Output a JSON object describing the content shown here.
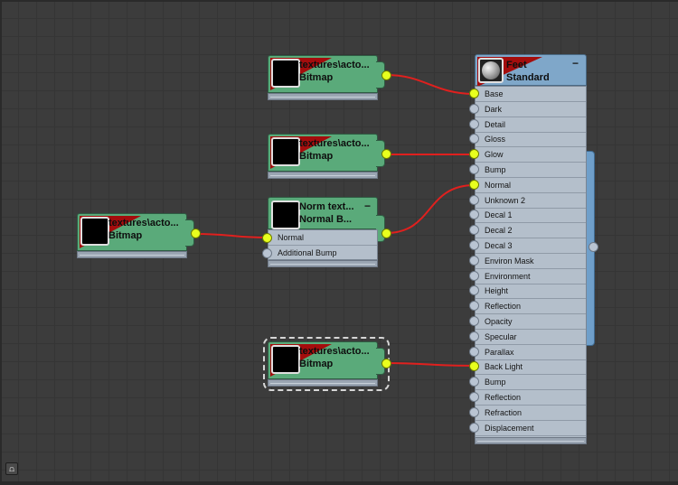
{
  "nodes": {
    "bitmap_base": {
      "line1": "textures\\acto...",
      "line2": "Bitmap"
    },
    "bitmap_glow": {
      "line1": "textures\\acto...",
      "line2": "Bitmap"
    },
    "bitmap_left": {
      "line1": "textures\\acto...",
      "line2": "Bitmap"
    },
    "normal_bump": {
      "line1": "Norm text...",
      "line2": "Normal B...",
      "minus": "−",
      "slots": [
        "Normal",
        "Additional Bump"
      ]
    },
    "bitmap_backlight": {
      "line1": "textures\\acto...",
      "line2": "Bitmap"
    }
  },
  "material": {
    "line1": "Feet",
    "line2": "Standard",
    "minus": "−",
    "slots": [
      {
        "label": "Base",
        "connected": true
      },
      {
        "label": "Dark",
        "connected": false
      },
      {
        "label": "Detail",
        "connected": false
      },
      {
        "label": "Gloss",
        "connected": false
      },
      {
        "label": "Glow",
        "connected": true
      },
      {
        "label": "Bump",
        "connected": false
      },
      {
        "label": "Normal",
        "connected": true
      },
      {
        "label": "Unknown 2",
        "connected": false
      },
      {
        "label": "Decal 1",
        "connected": false
      },
      {
        "label": "Decal 2",
        "connected": false
      },
      {
        "label": "Decal 3",
        "connected": false
      },
      {
        "label": "Environ Mask",
        "connected": false
      },
      {
        "label": "Environment",
        "connected": false
      },
      {
        "label": "Height",
        "connected": false
      },
      {
        "label": "Reflection",
        "connected": false
      },
      {
        "label": "Opacity",
        "connected": false
      },
      {
        "label": "Specular",
        "connected": false
      },
      {
        "label": "Parallax",
        "connected": false
      },
      {
        "label": "Back Light",
        "connected": true
      },
      {
        "label": "Bump",
        "connected": false
      },
      {
        "label": "Reflection",
        "connected": false
      },
      {
        "label": "Refraction",
        "connected": false
      },
      {
        "label": "Displacement",
        "connected": false
      }
    ]
  },
  "colors": {
    "node_green": "#5aaa7a",
    "material_blue": "#7fa7c9",
    "wire_red": "#e0201e",
    "port_active": "#e8ff1e"
  },
  "corner_button": {
    "icon": "view-toggle-icon",
    "glyph": "⩍"
  }
}
